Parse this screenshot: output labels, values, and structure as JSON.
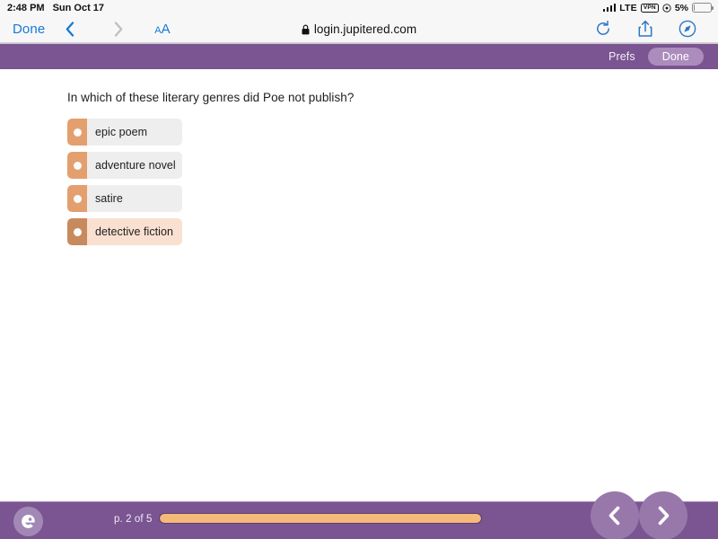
{
  "status_bar": {
    "time": "2:48 PM",
    "date": "Sun Oct 17",
    "network": "LTE",
    "vpn_badge": "VPN",
    "battery_percent": "5%",
    "battery_level": 5,
    "icons": [
      "signal-bars-icon",
      "vpn-badge-icon",
      "location-icon",
      "battery-icon"
    ]
  },
  "browser": {
    "done_label": "Done",
    "back_icon": "chevron-left-icon",
    "forward_icon": "chevron-right-icon",
    "text_size_small": "A",
    "text_size_large": "A",
    "lock_icon": "lock-icon",
    "url": "login.jupitered.com",
    "reload_icon": "reload-icon",
    "share_icon": "share-icon",
    "safari_icon": "safari-compass-icon"
  },
  "app_header": {
    "prefs_label": "Prefs",
    "done_label": "Done",
    "background_color": "#7a5591",
    "done_pill_color": "#ac8cbd"
  },
  "quiz": {
    "question": "In which of these literary genres did Poe not publish?",
    "options": [
      {
        "label": "epic poem",
        "selected": false
      },
      {
        "label": "adventure novel",
        "selected": false
      },
      {
        "label": "satire",
        "selected": false
      },
      {
        "label": "detective fiction",
        "selected": true
      }
    ],
    "option_tab_color": "#e3a06e",
    "option_tab_color_selected": "#c88a5c",
    "option_body_color": "#eeeeee",
    "option_body_color_selected": "#f9e0d0"
  },
  "footer": {
    "logo_icon": "jupitered-e-logo-icon",
    "page_label": "p. 2 of 5",
    "current_page": 2,
    "total_pages": 5,
    "progress_percent": 100,
    "progress_color": "#f5b97a",
    "prev_icon": "chevron-left-icon",
    "next_icon": "chevron-right-icon"
  }
}
